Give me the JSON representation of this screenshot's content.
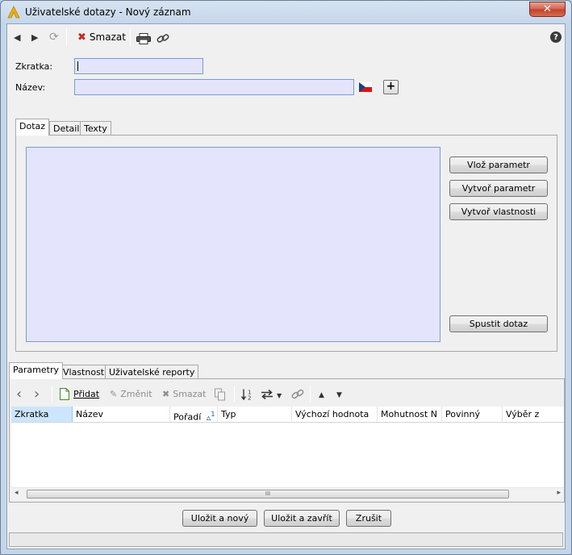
{
  "window": {
    "title": "Uživatelské dotazy - Nový záznam",
    "close_symbol": "✕"
  },
  "toolbar": {
    "back_symbol": "◀",
    "forward_symbol": "▶",
    "refresh_symbol": "⟳",
    "delete_symbol": "✖",
    "delete_label": "Smazat",
    "help_symbol": "?"
  },
  "form": {
    "zkratka_label": "Zkratka:",
    "zkratka_value": "",
    "nazev_label": "Název:",
    "nazev_value": "",
    "add_symbol": "+"
  },
  "top_tabs": [
    {
      "label": "Dotaz"
    },
    {
      "label": "Detail"
    },
    {
      "label": "Texty"
    }
  ],
  "query_panel": {
    "buttons": {
      "vloz_parametr": "Vlož parametr",
      "vytvor_parametr": "Vytvoř parametr",
      "vytvor_vlastnosti": "Vytvoř vlastnosti",
      "spustit_dotaz": "Spustit dotaz"
    },
    "editor_color": "#e4e4fd"
  },
  "bottom_tabs": [
    {
      "label": "Parametry"
    },
    {
      "label": "Vlastnosti"
    },
    {
      "label": "Uživatelské reporty"
    }
  ],
  "grid_toolbar": {
    "prev_symbol": "‹",
    "next_symbol": "›",
    "add_label": "Přidat",
    "edit_label": "Změnit",
    "delete_symbol": "✖",
    "delete_label": "Smazat",
    "up_symbol": "▲",
    "down_symbol": "▼",
    "dropdown_symbol": "▼"
  },
  "grid": {
    "columns": [
      {
        "label": "Zkratka"
      },
      {
        "label": "Název"
      },
      {
        "label": "Pořadí",
        "sort_symbol": "▵",
        "sort_index": "1"
      },
      {
        "label": "Typ"
      },
      {
        "label": "Výchozí hodnota"
      },
      {
        "label": "Mohutnost N"
      },
      {
        "label": "Povinný"
      },
      {
        "label": "Výběr z"
      }
    ],
    "rows": [],
    "scroll_left": "◂",
    "scroll_right": "▸",
    "scroll_grip": "III"
  },
  "footer": {
    "save_new": "Uložit a nový",
    "save_close": "Uložit a zavřít",
    "cancel": "Zrušit"
  },
  "colors": {
    "accent_red": "#c4291c",
    "input_bg": "#e4e4fd",
    "selected_col": "#cce6ff"
  }
}
